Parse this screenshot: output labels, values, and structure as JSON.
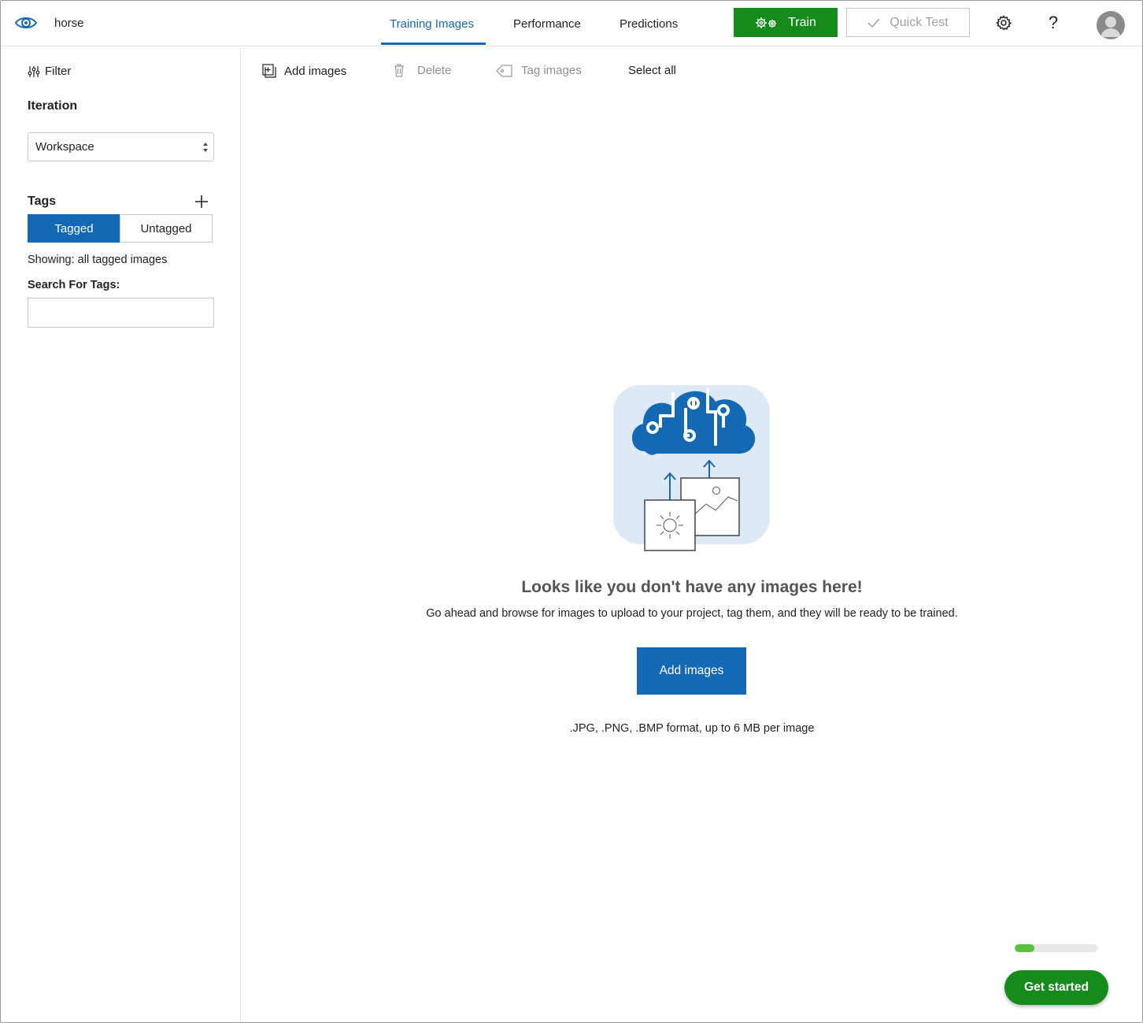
{
  "header": {
    "project_name": "horse",
    "tabs": [
      {
        "label": "Training Images",
        "active": true
      },
      {
        "label": "Performance",
        "active": false
      },
      {
        "label": "Predictions",
        "active": false
      }
    ],
    "train_label": "Train",
    "quick_test_label": "Quick Test",
    "icons": [
      "eye-logo-icon",
      "gears-icon",
      "check-icon",
      "settings-icon",
      "help-icon",
      "avatar"
    ]
  },
  "sidebar": {
    "filter_label": "Filter",
    "iteration_title": "Iteration",
    "iteration_selected": "Workspace",
    "tags_title": "Tags",
    "tagged_label": "Tagged",
    "untagged_label": "Untagged",
    "showing_text": "Showing: all tagged images",
    "search_label": "Search For Tags:",
    "search_value": ""
  },
  "toolbar": {
    "add_images": "Add images",
    "delete": "Delete",
    "tag_images": "Tag images",
    "select_all": "Select all"
  },
  "empty_state": {
    "title": "Looks like you don't have any images here!",
    "description": "Go ahead and browse for images to upload to your project, tag them, and they will be ready to be trained.",
    "button_label": "Add images",
    "formats": ".JPG, .PNG, .BMP format, up to 6 MB per image"
  },
  "onboarding": {
    "progress_fraction": 0.24,
    "get_started_label": "Get started"
  },
  "colors": {
    "accent_blue": "#1469b4",
    "train_green": "#158b1c",
    "progress_green": "#5ac13d"
  }
}
